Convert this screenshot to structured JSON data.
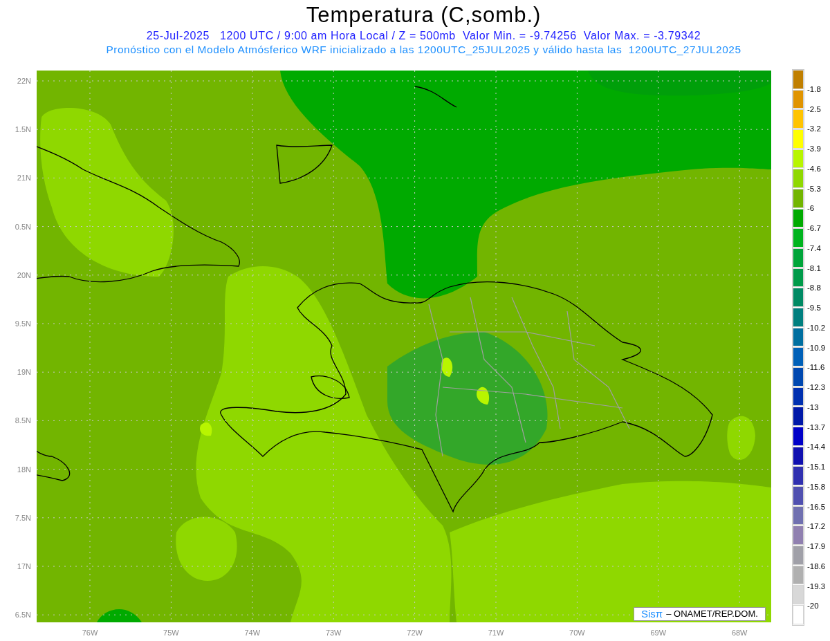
{
  "header": {
    "title": "Temperatura (C,somb.)",
    "line_1": "25-Jul-2025   1200 UTC / 9:00 am Hora Local / Z = 500mb  Valor Min. = -9.74256  Valor Max. = -3.79342",
    "line_2": "Pronóstico con el Modelo Atmósferico WRF inicializado a las 1200UTC_25JUL2025 y válido hasta las  1200UTC_27JUL2025"
  },
  "map": {
    "y_labels": [
      "22N",
      "1.5N",
      "21N",
      "0.5N",
      "20N",
      "9.5N",
      "19N",
      "8.5N",
      "18N",
      "7.5N",
      "17N",
      "6.5N"
    ],
    "x_labels": [
      "76W",
      "75W",
      "74W",
      "73W",
      "72W",
      "71W",
      "70W",
      "69W",
      "68W"
    ],
    "credit": {
      "logo": "Sisπ",
      "text": "– ONAMET/REP.DOM."
    }
  },
  "colorbar": {
    "bins": [
      {
        "color": "#c07f00",
        "label": "-1.8"
      },
      {
        "color": "#e09400",
        "label": "-2.5"
      },
      {
        "color": "#ffc400",
        "label": "-3.2"
      },
      {
        "color": "#ffff00",
        "label": "-3.9"
      },
      {
        "color": "#b8f500",
        "label": "-4.6"
      },
      {
        "color": "#8fd800",
        "label": "-5.3"
      },
      {
        "color": "#72b500",
        "label": "-6"
      },
      {
        "color": "#00aa00",
        "label": "-6.7"
      },
      {
        "color": "#00b41e",
        "label": "-7.4"
      },
      {
        "color": "#00a53a",
        "label": "-8.1"
      },
      {
        "color": "#009b4a",
        "label": "-8.8"
      },
      {
        "color": "#008a64",
        "label": "-9.5"
      },
      {
        "color": "#007f7f",
        "label": "-10.2"
      },
      {
        "color": "#006fa0",
        "label": "-10.9"
      },
      {
        "color": "#0060b8",
        "label": "-11.6"
      },
      {
        "color": "#0048b0",
        "label": "-12.3"
      },
      {
        "color": "#0030b0",
        "label": "-13"
      },
      {
        "color": "#0018a8",
        "label": "-13.7"
      },
      {
        "color": "#0000c8",
        "label": "-14.4"
      },
      {
        "color": "#1010b0",
        "label": "-15.1"
      },
      {
        "color": "#3030b0",
        "label": "-15.8"
      },
      {
        "color": "#5050b0",
        "label": "-16.5"
      },
      {
        "color": "#7070b0",
        "label": "-17.2"
      },
      {
        "color": "#9080b0",
        "label": "-17.9"
      },
      {
        "color": "#a0a0a8",
        "label": "-18.6"
      },
      {
        "color": "#b0b0b0",
        "label": "-19.3"
      },
      {
        "color": "#d8d8d8",
        "label": "-20"
      },
      {
        "color": "#ffffff"
      }
    ]
  }
}
